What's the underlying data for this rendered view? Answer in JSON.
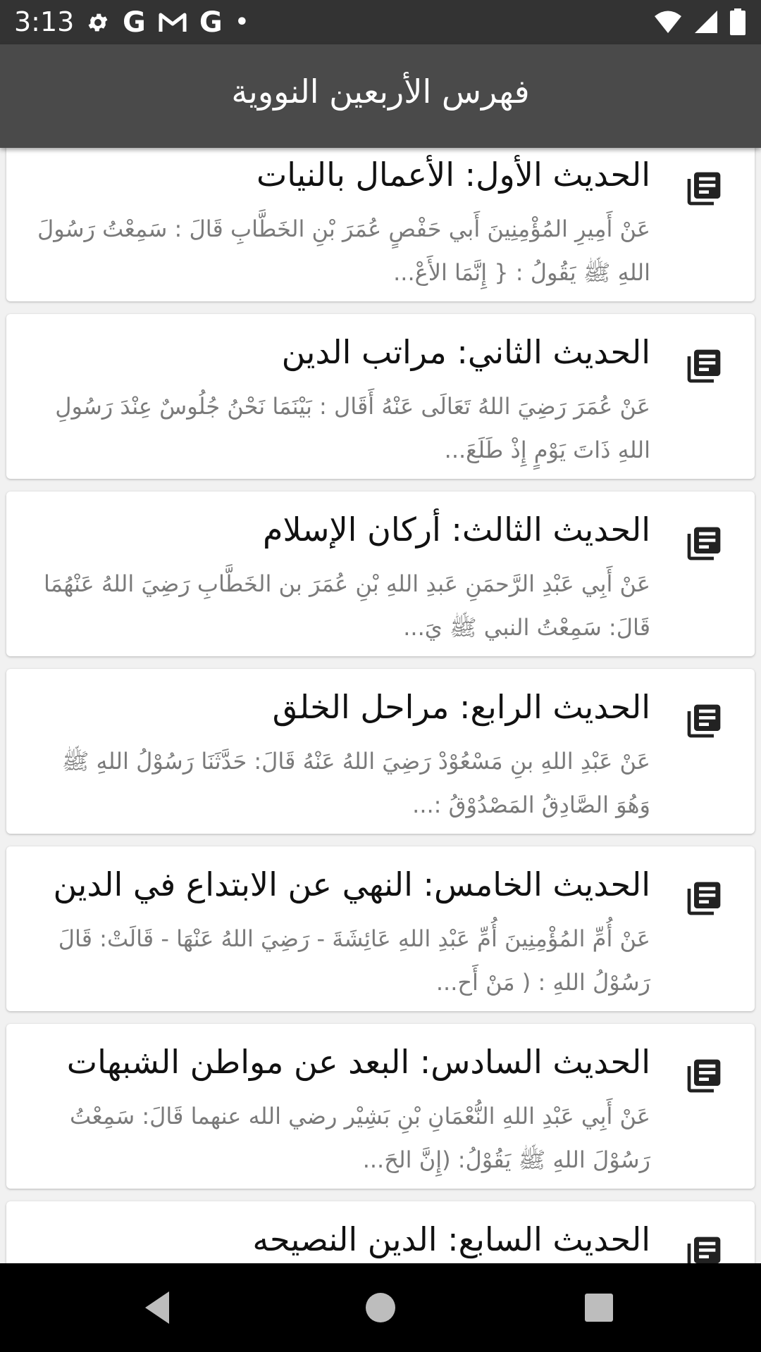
{
  "status_bar": {
    "time": "3:13",
    "left_icons": [
      "gear-icon",
      "google-icon",
      "gmail-icon",
      "google-icon",
      "dot-icon"
    ],
    "right_icons": [
      "wifi-icon",
      "signal-icon",
      "battery-icon"
    ]
  },
  "app_bar": {
    "title": "فهرس الأربعين النووية"
  },
  "hadith_list": [
    {
      "title": "الحديث الأول: الأعمال بالنيات",
      "preview": "عَنْ أَمِيرِ المُؤْمِنِينَ أَبي حَفْصٍ عُمَرَ بْنِ الخَطَّابِ قَالَ : سَمِعْتُ رَسُولَ اللهِ ﷺ يَقُولُ : { إِنَّمَا الأَعْ..."
    },
    {
      "title": "الحديث الثاني: مراتب الدين",
      "preview": "عَنْ عُمَرَ رَضِيَ اللهُ تَعَالَى عَنْهُ أَقَال : بَيْنَمَا نَحْنُ جُلُوسٌ عِنْدَ رَسُولِ اللهِ ذَاتَ يَوْمٍ إِذْ طَلَعَ..."
    },
    {
      "title": "الحديث الثالث: أركان الإسلام",
      "preview": "عَنْ أَبِي عَبْدِ الرَّحمَنِ عَبدِ اللهِ بْنِ عُمَرَ بن الخَطَّابِ رَضِيَ اللهُ عَنْهُمَا قَالَ: سَمِعْتُ النبي ﷺ يَ..."
    },
    {
      "title": "الحديث الرابع: مراحل الخلق",
      "preview": "عَنْ عَبْدِ اللهِ بنِ مَسْعُوْدْ رَضِيَ اللهُ عَنْهُ قَالَ: حَدَّثَنَا رَسُوْلُ اللهِ ﷺ وَهُوَ الصَّادِقُ المَصْدُوْقُ :..."
    },
    {
      "title": "الحديث الخامس: النهي عن الابتداع في الدين",
      "preview": "عَنْ أُمِّ المُؤْمِنِينَ أُمِّ عَبْدِ اللهِ عَائِشَةَ - رَضِيَ اللهُ عَنْهَا - قَالَتْ: قَالَ رَسُوْلُ اللهِ : ( مَنْ أَح..."
    },
    {
      "title": "الحديث السادس: البعد عن مواطن الشبهات",
      "preview": "عَنْ أَبِي عَبْدِ اللهِ النُّعْمَانِ بْنِ بَشِيْر رضي الله عنهما قَالَ: سَمِعْتُ رَسُوْلَ اللهِ ﷺ يَقُوْلُ: (إِنَّ الحَ..."
    },
    {
      "title": "الحديث السابع: الدين النصيحه",
      "preview": ""
    }
  ],
  "nav_bar": {
    "buttons": [
      "back-icon",
      "home-icon",
      "recents-icon"
    ]
  }
}
